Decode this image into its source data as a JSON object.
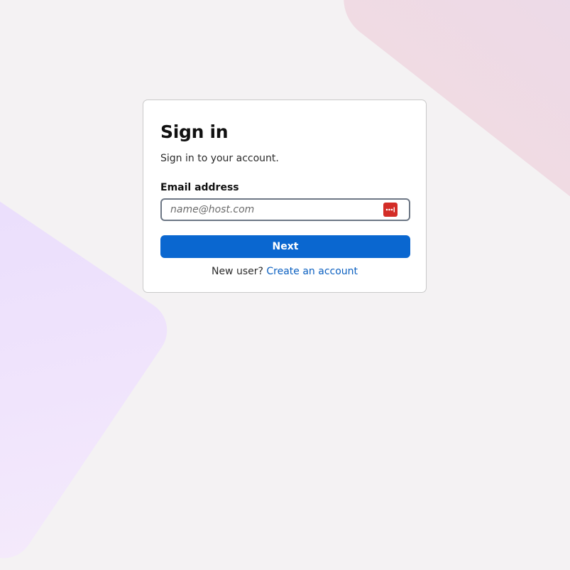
{
  "signin": {
    "title": "Sign in",
    "subtitle": "Sign in to your account.",
    "email_label": "Email address",
    "email_value": "",
    "email_placeholder": "name@host.com",
    "next_label": "Next",
    "new_user_text": "New user?",
    "create_account_label": "Create an account"
  },
  "icons": {
    "password_manager": "password-manager-icon"
  },
  "colors": {
    "background": "#f4f2f3",
    "primary_button": "#0a67d0",
    "link": "#0a5fc0",
    "password_manager_icon": "#d32d27"
  }
}
